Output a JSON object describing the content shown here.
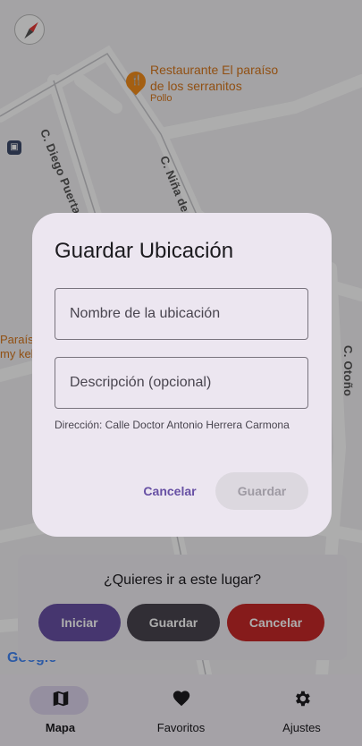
{
  "map": {
    "poi_name": "Restaurante El paraíso de los serranitos",
    "poi_type": "Pollo",
    "streets": [
      "C. Diego Puerta",
      "C. Niña de la",
      "C. Otoño"
    ],
    "side_poi": "Paraís\nmy keb",
    "attribution": "Google"
  },
  "sheet": {
    "question": "¿Quieres ir a este lugar?",
    "start_label": "Iniciar",
    "save_label": "Guardar",
    "cancel_label": "Cancelar",
    "colors": {
      "start": "#6750a4",
      "save": "#49454f",
      "cancel": "#c62828"
    }
  },
  "dialog": {
    "title": "Guardar Ubicación",
    "name_placeholder": "Nombre de la ubicación",
    "name_value": "",
    "description_placeholder": "Descripción (opcional)",
    "description_value": "",
    "address": "Dirección: Calle Doctor Antonio Herrera Carmona",
    "cancel_label": "Cancelar",
    "save_label": "Guardar",
    "save_enabled": false
  },
  "nav": {
    "items": [
      {
        "label": "Mapa",
        "icon": "map-icon",
        "selected": true
      },
      {
        "label": "Favoritos",
        "icon": "heart-icon",
        "selected": false
      },
      {
        "label": "Ajustes",
        "icon": "gear-icon",
        "selected": false
      }
    ]
  }
}
